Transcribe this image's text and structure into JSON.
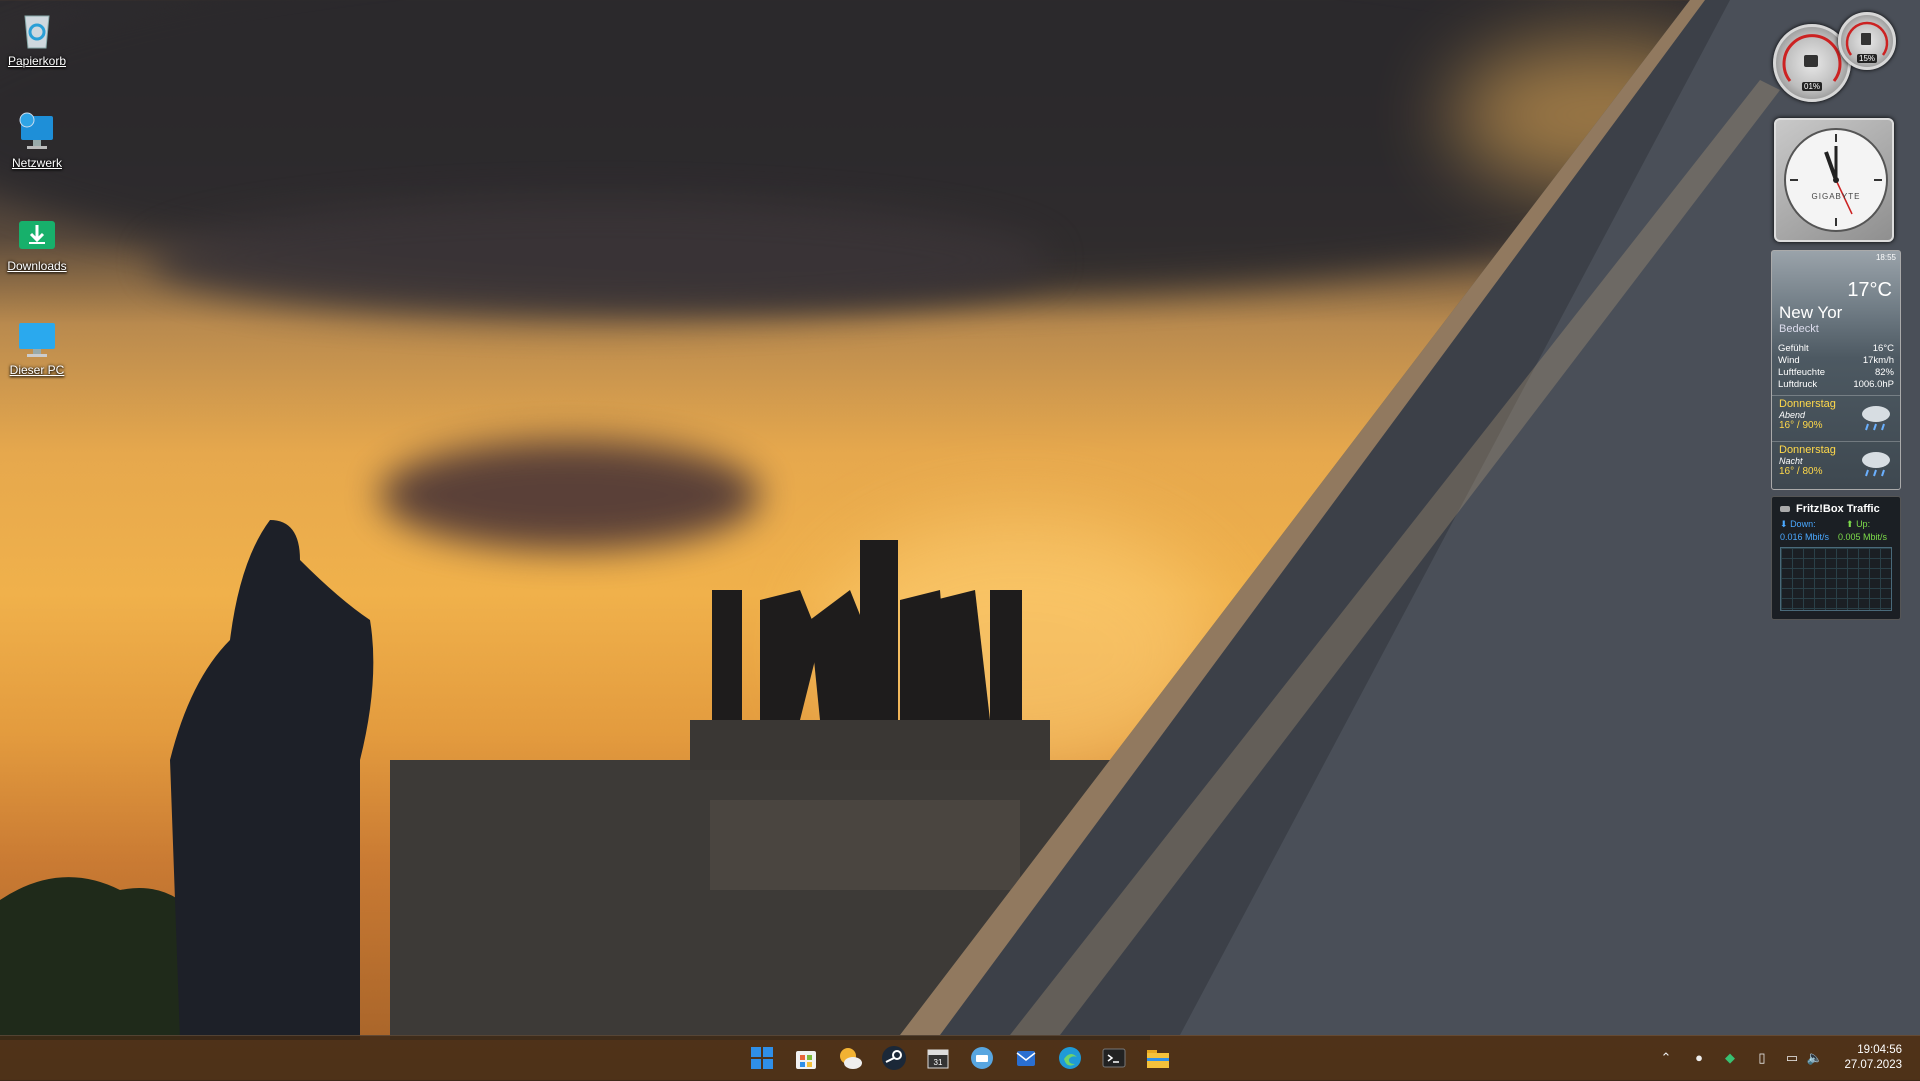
{
  "desktop": {
    "icons": [
      {
        "label": "Papierkorb",
        "icon": "recycle-bin-icon"
      },
      {
        "label": "Netzwerk",
        "icon": "network-icon"
      },
      {
        "label": "Downloads",
        "icon": "downloads-folder-icon"
      },
      {
        "label": "Dieser PC",
        "icon": "this-pc-icon"
      }
    ]
  },
  "gadgets": {
    "cpu_gauge": {
      "value": "01%"
    },
    "mem_gauge": {
      "value": "15%"
    },
    "clock": {
      "brand": "GIGABYTE"
    },
    "weather": {
      "time": "18:55",
      "temp": "17°C",
      "city": "New Yor",
      "condition": "Bedeckt",
      "details": [
        {
          "label": "Gefühlt",
          "value": "16°C"
        },
        {
          "label": "Wind",
          "value": "17km/h"
        },
        {
          "label": "Luftfeuchte",
          "value": "82%"
        },
        {
          "label": "Luftdruck",
          "value": "1006.0hP"
        }
      ],
      "forecast": [
        {
          "day": "Donnerstag",
          "tod": "Abend",
          "temp": "16° / 90%"
        },
        {
          "day": "Donnerstag",
          "tod": "Nacht",
          "temp": "16° / 80%"
        }
      ]
    },
    "fritz": {
      "title": "Fritz!Box Traffic",
      "down_label": "Down:",
      "up_label": "Up:",
      "down_value": "0.016 Mbit/s",
      "up_value": "0.005 Mbit/s"
    }
  },
  "taskbar": {
    "apps": [
      {
        "name": "start",
        "icon": "windows-start-icon",
        "color": "#2f8fe8"
      },
      {
        "name": "store",
        "icon": "store-icon",
        "color": "#e8643a"
      },
      {
        "name": "weather",
        "icon": "weather-app-icon",
        "color": "#f2b233"
      },
      {
        "name": "steam",
        "icon": "steam-icon",
        "color": "#1b2838"
      },
      {
        "name": "calendar",
        "icon": "calendar-app-icon",
        "color": "#333333"
      },
      {
        "name": "remote",
        "icon": "remote-app-icon",
        "color": "#58a6e0"
      },
      {
        "name": "outlook",
        "icon": "mail-app-icon",
        "color": "#2a6fd1"
      },
      {
        "name": "edge",
        "icon": "edge-browser-icon",
        "color": "#1f9ad6"
      },
      {
        "name": "terminal",
        "icon": "terminal-icon",
        "color": "#222222"
      },
      {
        "name": "explorer",
        "icon": "file-explorer-icon",
        "color": "#f4c13b"
      }
    ],
    "tray": [
      "chevron-up-icon",
      "steam-tray-icon",
      "defender-icon",
      "battery-icon",
      "network-tray-icon",
      "volume-icon"
    ],
    "time": "19:04:56",
    "date": "27.07.2023"
  }
}
